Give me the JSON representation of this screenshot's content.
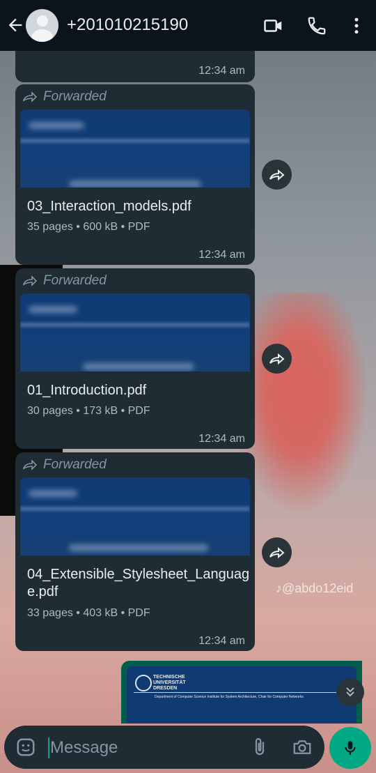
{
  "header": {
    "contact": "+201010215190"
  },
  "messages": [
    {
      "time": "12:34 am"
    },
    {
      "forwarded": "Forwarded",
      "file": "03_Interaction_models.pdf",
      "meta": "35 pages • 600 kB • PDF",
      "time": "12:34 am"
    },
    {
      "forwarded": "Forwarded",
      "file": "01_Introduction.pdf",
      "meta": "30 pages • 173 kB • PDF",
      "time": "12:34 am"
    },
    {
      "forwarded": "Forwarded",
      "file": "04_Extensible_Stylesheet_Language.pdf",
      "meta": "33 pages • 403 kB • PDF",
      "time": "12:34 am"
    }
  ],
  "outgoing_preview": {
    "org": "TECHNISCHE UNIVERSITÄT DRESDEN",
    "line": "Department of Computer Science Institute for System Architecture, Chair for Computer Networks"
  },
  "watermark": "@abdo12eid",
  "composer": {
    "placeholder": "Message"
  },
  "icons": [
    "back-arrow-icon",
    "video-call-icon",
    "phone-icon",
    "more-options-icon",
    "forward-icon",
    "share-icon",
    "chevron-double-down-icon",
    "emoji-icon",
    "attach-icon",
    "camera-icon",
    "mic-icon"
  ],
  "colors": {
    "header": "#0b141a",
    "bubble": "#202c33",
    "accent": "#00a884",
    "outgoing": "#005c4b"
  }
}
